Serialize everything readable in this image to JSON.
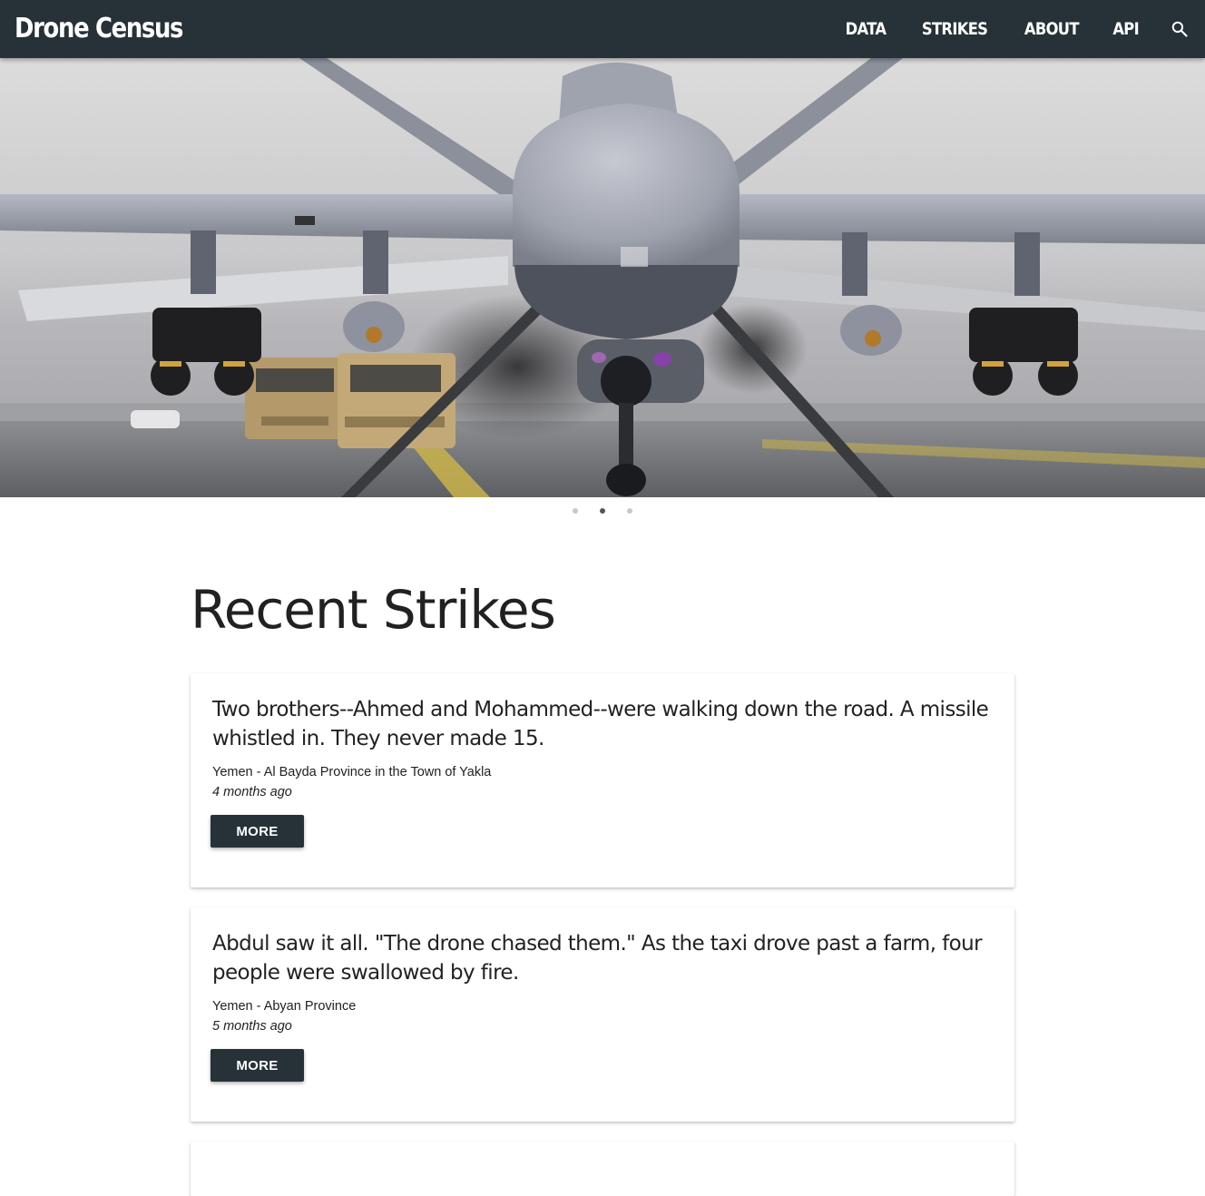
{
  "navbar": {
    "brand": "Drone Census",
    "links": [
      "DATA",
      "STRIKES",
      "ABOUT",
      "API"
    ],
    "search_icon": "search-icon",
    "background": "#263238"
  },
  "hero": {
    "image": "drone-on-runway",
    "dots": 3,
    "active_dot": 2
  },
  "main": {
    "title": "Recent Strikes",
    "strikes": [
      {
        "headline": "Two brothers--Ahmed and Mohammed--were walking down the road. A missile whistled in. They never made 15.",
        "location": "Yemen - Al Bayda Province in the Town of Yakla",
        "time": "4 months ago",
        "button": "MORE"
      },
      {
        "headline": "Abdul saw it all. \"The drone chased them.\" As the taxi drove past a farm, four people were swallowed by fire.",
        "location": "Yemen - Abyan Province",
        "time": "5 months ago",
        "button": "MORE"
      }
    ]
  }
}
